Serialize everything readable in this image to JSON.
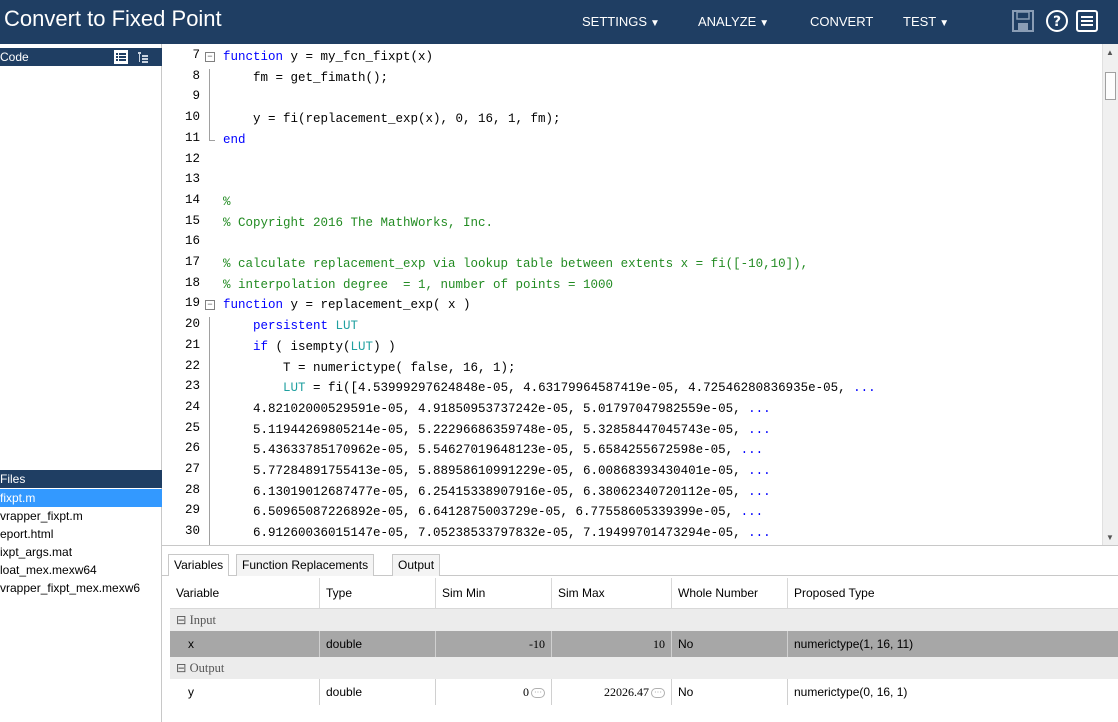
{
  "app": {
    "title": "Convert to Fixed Point",
    "menus": [
      {
        "label": "SETTINGS",
        "caret": "▼"
      },
      {
        "label": "ANALYZE",
        "caret": "▼"
      },
      {
        "label": "CONVERT",
        "caret": ""
      },
      {
        "label": "TEST",
        "caret": "▼"
      }
    ],
    "toolbar_icons": [
      "save-icon",
      "help-icon",
      "menu-icon"
    ]
  },
  "left_panel": {
    "code_header": "Code",
    "files_header": "Files",
    "files": [
      {
        "name": "fixpt.m",
        "selected": true
      },
      {
        "name": "vrapper_fixpt.m",
        "selected": false
      },
      {
        "name": "eport.html",
        "selected": false
      },
      {
        "name": "ixpt_args.mat",
        "selected": false
      },
      {
        "name": "loat_mex.mexw64",
        "selected": false
      },
      {
        "name": "vrapper_fixpt_mex.mexw6",
        "selected": false
      }
    ]
  },
  "editor": {
    "lines": [
      {
        "n": "7",
        "text": "function y = my_fcn_fixpt(x)"
      },
      {
        "n": "8",
        "text": "    fm = get_fimath();"
      },
      {
        "n": "9",
        "text": ""
      },
      {
        "n": "10",
        "text": "    y = fi(replacement_exp(x), 0, 16, 1, fm);"
      },
      {
        "n": "11",
        "text": "end"
      },
      {
        "n": "12",
        "text": ""
      },
      {
        "n": "13",
        "text": ""
      },
      {
        "n": "14",
        "text": "%"
      },
      {
        "n": "15",
        "text": "% Copyright 2016 The MathWorks, Inc."
      },
      {
        "n": "16",
        "text": ""
      },
      {
        "n": "17",
        "text": "% calculate replacement_exp via lookup table between extents x = fi([-10,10]),"
      },
      {
        "n": "18",
        "text": "% interpolation degree  = 1, number of points = 1000"
      },
      {
        "n": "19",
        "text": "function y = replacement_exp( x )"
      },
      {
        "n": "20",
        "text": "    persistent LUT"
      },
      {
        "n": "21",
        "text": "    if ( isempty(LUT) )"
      },
      {
        "n": "22",
        "text": "        T = numerictype( false, 16, 1);"
      },
      {
        "n": "23",
        "text": "        LUT = fi([4.53999297624848e-05, 4.63179964587419e-05, 4.72546280836935e-05, ..."
      },
      {
        "n": "24",
        "text": "    4.82102000529591e-05, 4.91850953737242e-05, 5.01797047982559e-05, ..."
      },
      {
        "n": "25",
        "text": "    5.11944269805214e-05, 5.22296686359748e-05, 5.32858447045743e-05, ..."
      },
      {
        "n": "26",
        "text": "    5.43633785170962e-05, 5.54627019648123e-05, 5.6584255672598e-05, ..."
      },
      {
        "n": "27",
        "text": "    5.77284891755413e-05, 5.88958610991229e-05, 6.00868393430401e-05, ..."
      },
      {
        "n": "28",
        "text": "    6.13019012687477e-05, 6.25415338907916e-05, 6.38062340720112e-05, ..."
      },
      {
        "n": "29",
        "text": "    6.50965087226892e-05, 6.6412875003729e-05, 6.77558605339399e-05, ..."
      },
      {
        "n": "30",
        "text": "    6.91260036015147e-05, 7.05238533797832e-05, 7.19499701473294e-05, ..."
      }
    ]
  },
  "bottom": {
    "tabs": [
      "Variables",
      "Function Replacements",
      "Output"
    ],
    "columns": [
      "Variable",
      "Type",
      "Sim Min",
      "Sim Max",
      "Whole Number",
      "Proposed Type"
    ],
    "groups": [
      {
        "label": "Input",
        "toggle": "⊟",
        "rows": [
          {
            "variable": "x",
            "type": "double",
            "sim_min": "-10",
            "sim_max": "10",
            "whole": "No",
            "proposed": "numerictype(1, 16, 11)",
            "selected": true,
            "min_more": false,
            "max_more": false
          }
        ]
      },
      {
        "label": "Output",
        "toggle": "⊟",
        "rows": [
          {
            "variable": "y",
            "type": "double",
            "sim_min": "0",
            "sim_max": "22026.47",
            "whole": "No",
            "proposed": "numerictype(0, 16, 1)",
            "selected": false,
            "min_more": true,
            "max_more": true
          }
        ]
      }
    ]
  }
}
